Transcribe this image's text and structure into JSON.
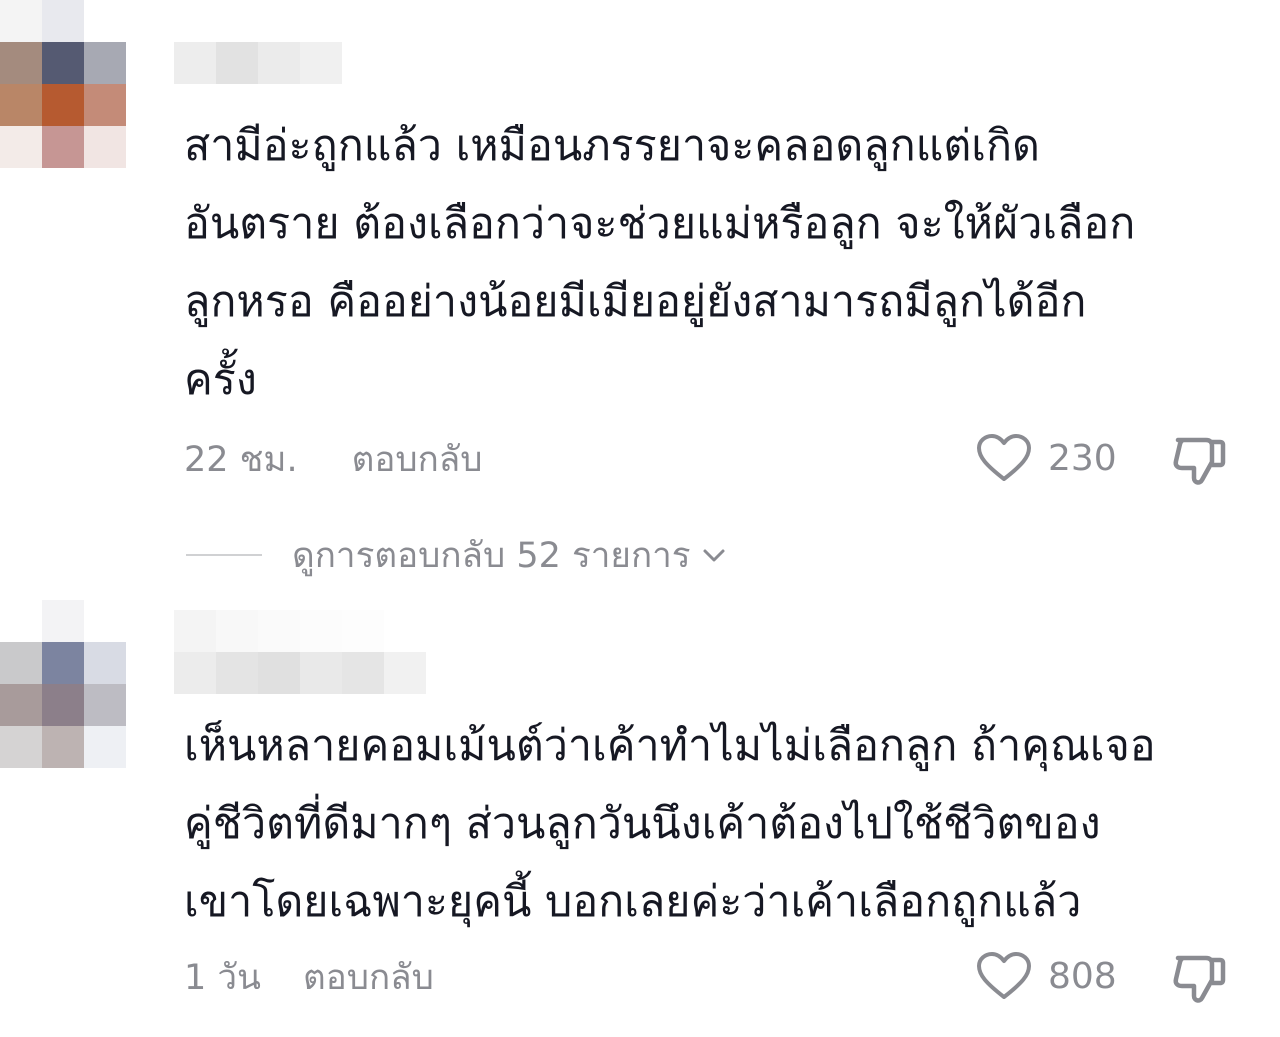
{
  "comments": [
    {
      "text": "สามีอ่ะถูกแล้ว เหมือนภรรยาจะคลอดลูกแต่เกิดอันตราย ต้องเลือกว่าจะช่วยแม่หรือลูก จะให้ผัวเลือกลูกหรอ คืออย่างน้อยมีเมียอยู่ยังสามารถมีลูกได้อีกครั้ง",
      "lines": [
        "สามีอ่ะถูกแล้ว เหมือนภรรยาจะคลอดลูกแต่เกิด",
        "อันตราย ต้องเลือกว่าจะช่วยแม่หรือลูก จะให้ผัวเลือก",
        "ลูกหรอ คืออย่างน้อยมีเมียอยู่ยังสามารถมีลูกได้อีก",
        "ครั้ง"
      ],
      "time": "22 ชม.",
      "reply_label": "ตอบกลับ",
      "like_count": "230",
      "view_replies": "ดูการตอบกลับ 52 รายการ"
    },
    {
      "lines": [
        "เห็นหลายคอมเม้นต์ว่าเค้าทำไมไม่เลือกลูก ถ้าคุณเจอ",
        "คู่ชีวิตที่ดีมากๆ ส่วนลูกวันนึงเค้าต้องไปใช้ชีวิตของ",
        "เขาโดยเฉพาะยุคนี้ บอกเลยค่ะว่าเค้าเลือกถูกแล้ว"
      ],
      "time": "1 วัน",
      "reply_label": "ตอบกลับ",
      "like_count": "808"
    }
  ],
  "icons": {
    "like": "heart-outline-icon",
    "dislike": "thumbs-down-outline-icon",
    "expand": "chevron-down-icon"
  },
  "colors": {
    "text": "#161823",
    "secondary": "#8a8b91",
    "divider": "#d0d1d3"
  }
}
